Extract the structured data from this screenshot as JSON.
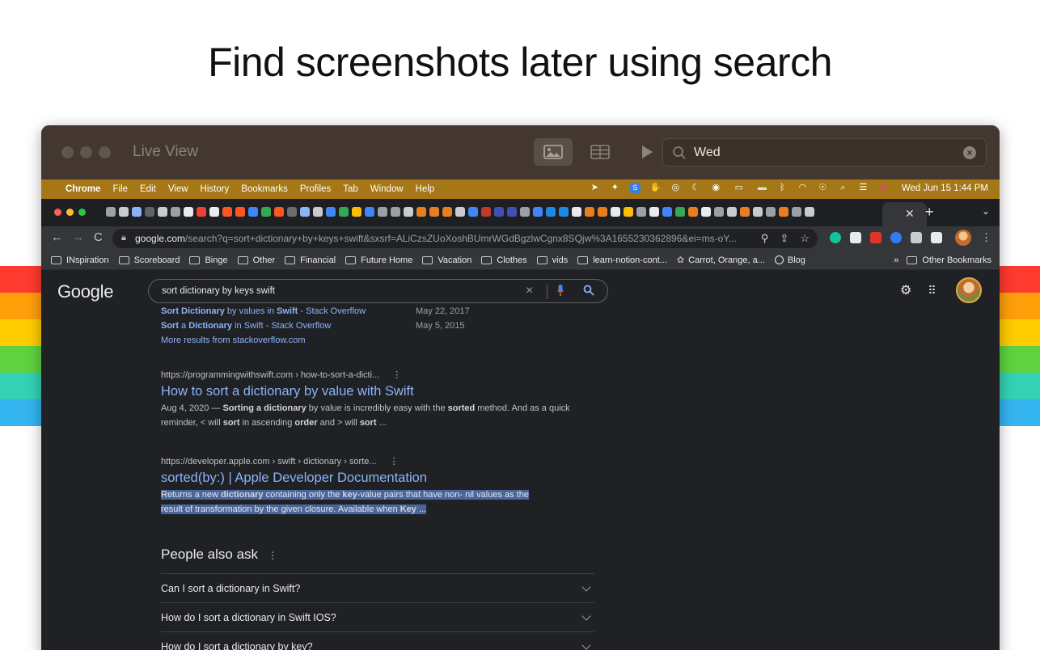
{
  "headline": "Find screenshots later using search",
  "rainbow": [
    "#ff3a2f",
    "#ff9f0a",
    "#ffcc00",
    "#5ed23f",
    "#34d1b4",
    "#34b5f0"
  ],
  "app": {
    "title": "Live View",
    "search_value": "Wed",
    "toolbar_icons": [
      "image-view-icon",
      "grid-view-icon",
      "play-icon"
    ]
  },
  "menubar": {
    "app": "Chrome",
    "items": [
      "File",
      "Edit",
      "View",
      "History",
      "Bookmarks",
      "Profiles",
      "Tab",
      "Window",
      "Help"
    ],
    "clock": "Wed Jun 15  1:44 PM"
  },
  "browser": {
    "url_host": "google.com",
    "url_path": "/search?q=sort+dictionary+by+keys+swift&sxsrf=ALiCzsZUoXoshBUmrWGdBgzlwCgnx8SQjw%3A1655230362896&ei=ms-oY...",
    "bookmarks": [
      "INspiration",
      "Scoreboard",
      "Binge",
      "Other",
      "Financial",
      "Future Home",
      "Vacation",
      "Clothes",
      "vids",
      "learn-notion-cont...",
      "Carrot, Orange, a...",
      "Blog"
    ],
    "other_bookmarks": "Other Bookmarks",
    "overflow": "»"
  },
  "google": {
    "logo": "Google",
    "query": "sort dictionary by keys swift",
    "sub_results": [
      {
        "pre": "",
        "b1": "Sort Dictionary",
        "mid": " by values in ",
        "b2": "Swift",
        "post": " - Stack Overflow",
        "date": "May 22, 2017"
      },
      {
        "pre": "",
        "b1": "Sort",
        "mid": " a ",
        "b2": "Dictionary",
        "post": " in Swift - Stack Overflow",
        "date": "May 5, 2015"
      }
    ],
    "more_results": "More results from stackoverflow.com",
    "result1": {
      "cite": "https://programmingwithswift.com › how-to-sort-a-dicti...",
      "title": "How to sort a dictionary by value with Swift",
      "s1": "Aug 4, 2020 — ",
      "s2": "Sorting a dictionary",
      "s3": " by value is incredibly easy with the ",
      "s4": "sorted",
      "s5": " method. And as a quick reminder, < will ",
      "s6": "sort",
      "s7": " in ascending ",
      "s8": "order",
      "s9": " and > will ",
      "s10": "sort",
      "s11": " ..."
    },
    "result2": {
      "cite": "https://developer.apple.com › swift › dictionary › sorte...",
      "title": "sorted(by:) | Apple Developer Documentation",
      "line1a": "Returns a new ",
      "line1b": "dictionary",
      "line1c": " containing only the ",
      "line1d": "key",
      "line1e": "-value pairs that have non- nil values as the",
      "line2a": "result of transformation by the given closure. Available when ",
      "line2b": "Key",
      "line2c": " ..."
    },
    "paa_title": "People also ask",
    "paa": [
      "Can I sort a dictionary in Swift?",
      "How do I sort a dictionary in Swift IOS?",
      "How do I sort a dictionary by key?"
    ]
  }
}
